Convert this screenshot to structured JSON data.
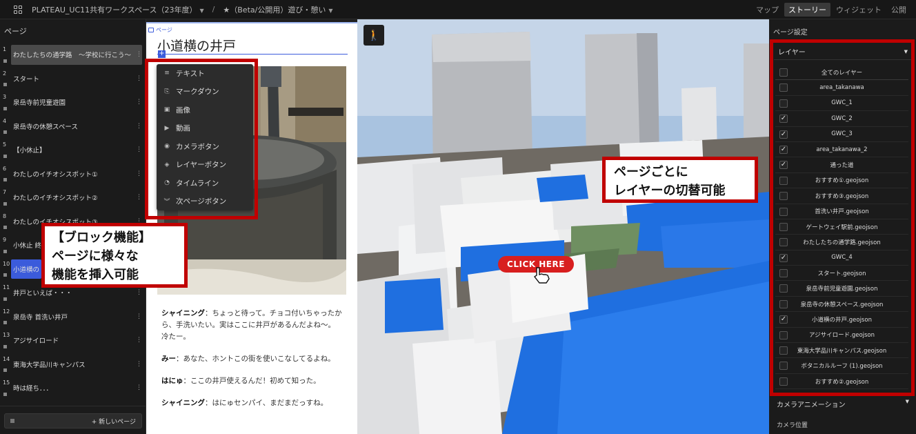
{
  "topbar": {
    "workspace": "PLATEAU_UC11共有ワークスペース（23年度）",
    "separator": "/",
    "project": "★（Beta/公開用）遊び・憩い",
    "tabs": [
      {
        "label": "マップ"
      },
      {
        "label": "ストーリー"
      },
      {
        "label": "ウィジェット"
      },
      {
        "label": "公開"
      }
    ]
  },
  "left": {
    "title": "ページ",
    "pages": [
      {
        "num": "1",
        "label": "わたしたちの通学路　～学校に行こう～"
      },
      {
        "num": "2",
        "label": "スタート"
      },
      {
        "num": "3",
        "label": "泉岳寺前児童遊園"
      },
      {
        "num": "4",
        "label": "泉岳寺の休憩スペース"
      },
      {
        "num": "5",
        "label": "【小休止】"
      },
      {
        "num": "6",
        "label": "わたしのイチオシスポット①"
      },
      {
        "num": "7",
        "label": "わたしのイチオシスポット②"
      },
      {
        "num": "8",
        "label": "わたしのイチオシスポット③"
      },
      {
        "num": "9",
        "label": "小休止 終"
      },
      {
        "num": "10",
        "label": "小道横の"
      },
      {
        "num": "11",
        "label": "井戸といえば・・・"
      },
      {
        "num": "12",
        "label": "泉岳寺 首洗い井戸"
      },
      {
        "num": "13",
        "label": "アジサイロード"
      },
      {
        "num": "14",
        "label": "東海大学品川キャンパス"
      },
      {
        "num": "15",
        "label": "時は経ち．．．"
      }
    ],
    "new_page": "+ 新しいページ"
  },
  "story": {
    "page_tag": "ページ",
    "title": "小道横の井戸",
    "dialogs": [
      {
        "speaker": "シャイニング",
        "text": "：ちょっと待って。チョコ付いちゃったから、手洗いたい。実はここに井戸があるんだよね～。　冷たー。"
      },
      {
        "speaker": "みー",
        "text": "：あなた、ホントこの街を使いこなしてるよね。"
      },
      {
        "speaker": "はにゅ",
        "text": "：ここの井戸使えるんだ！初めて知った。"
      },
      {
        "speaker": "シャイニング",
        "text": "：はにゅセンパイ、まだまだっすね。"
      }
    ]
  },
  "block_menu": {
    "items": [
      {
        "icon": "text-icon",
        "glyph": "≡",
        "label": "テキスト"
      },
      {
        "icon": "markdown-icon",
        "glyph": "⎘",
        "label": "マークダウン"
      },
      {
        "icon": "image-icon",
        "glyph": "▣",
        "label": "画像"
      },
      {
        "icon": "video-icon",
        "glyph": "▶",
        "label": "動画"
      },
      {
        "icon": "camera-icon",
        "glyph": "◉",
        "label": "カメラボタン"
      },
      {
        "icon": "layers-icon",
        "glyph": "◈",
        "label": "レイヤーボタン"
      },
      {
        "icon": "clock-icon",
        "glyph": "◔",
        "label": "タイムライン"
      },
      {
        "icon": "chevrons-down-icon",
        "glyph": "︾",
        "label": "次ページボタン"
      }
    ]
  },
  "callouts": {
    "block_line1": "【ブロック機能】",
    "block_line2": "ページに様々な",
    "block_line3": "機能を挿入可能",
    "layer_line1": "ページごとに",
    "layer_line2": "レイヤーの切替可能"
  },
  "viewport": {
    "click_here": "CLICK HERE",
    "walk_glyph": "🚶"
  },
  "right": {
    "title": "ページ設定",
    "layer_header": "レイヤー",
    "all_layers": "全てのレイヤー",
    "layers": [
      {
        "name": "area_takanawa",
        "checked": false
      },
      {
        "name": "GWC_1",
        "checked": false
      },
      {
        "name": "GWC_2",
        "checked": true
      },
      {
        "name": "GWC_3",
        "checked": true
      },
      {
        "name": "area_takanawa_2",
        "checked": true
      },
      {
        "name": "通った道",
        "checked": true
      },
      {
        "name": "おすすめ①.geojson",
        "checked": false
      },
      {
        "name": "おすすめ③.geojson",
        "checked": false
      },
      {
        "name": "首洗い井戸.geojson",
        "checked": false
      },
      {
        "name": "ゲートウェイ駅前.geojson",
        "checked": false
      },
      {
        "name": "わたしたちの通学路.geojson",
        "checked": false
      },
      {
        "name": "GWC_4",
        "checked": true
      },
      {
        "name": "スタート.geojson",
        "checked": false
      },
      {
        "name": "泉岳寺前児童遊園.geojson",
        "checked": false
      },
      {
        "name": "泉岳寺の休憩スペース.geojson",
        "checked": false
      },
      {
        "name": "小道横の井戸.geojson",
        "checked": true
      },
      {
        "name": "アジサイロード.geojson",
        "checked": false
      },
      {
        "name": "東海大学品川キャンパス.geojson",
        "checked": false
      },
      {
        "name": "ボタニカルルーフ (1).geojson",
        "checked": false
      },
      {
        "name": "おすすめ②.geojson",
        "checked": false
      }
    ],
    "camera_header": "カメラアニメーション",
    "camera_position": "カメラ位置"
  },
  "colors": {
    "accent": "#3b5bdb",
    "callout_red": "#c00000",
    "building_blue": "#1f6fe0",
    "click_red": "#d81f1f"
  }
}
